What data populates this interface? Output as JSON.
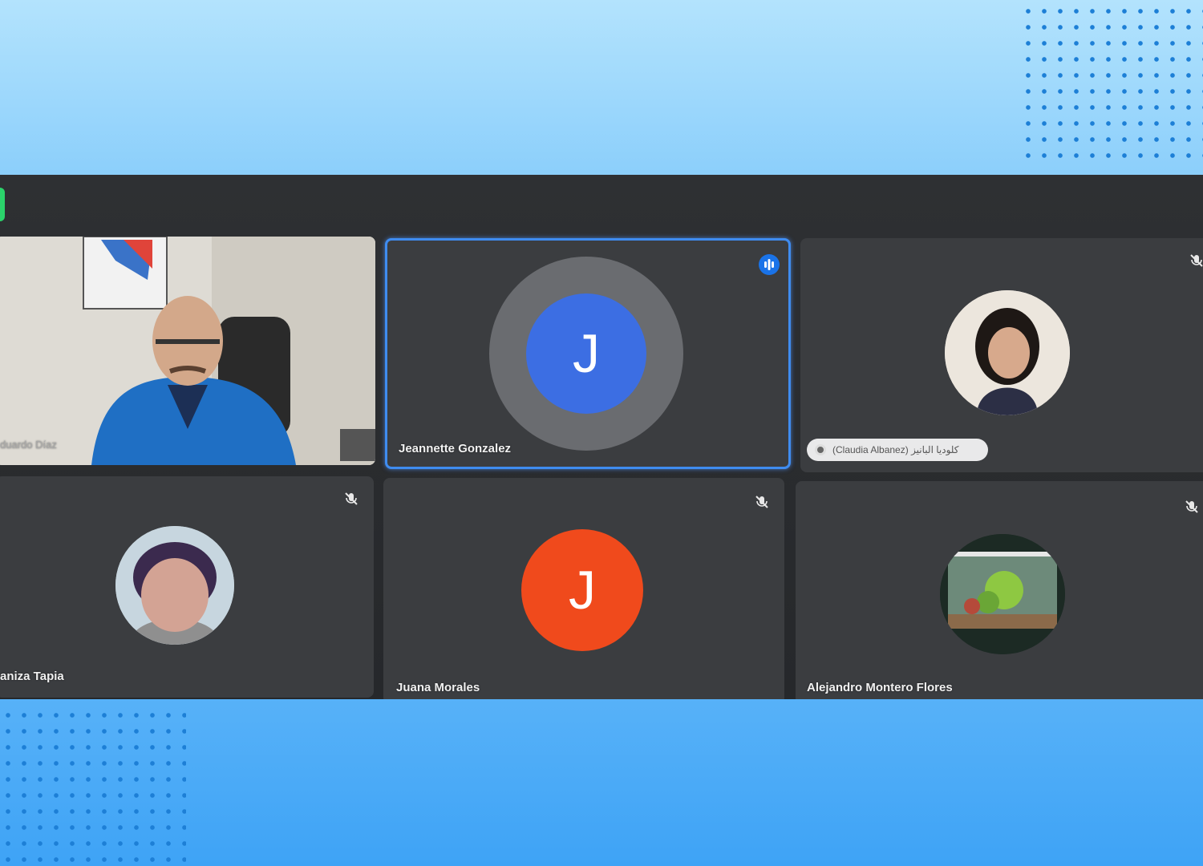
{
  "colors": {
    "accent_blue": "#3f8cf0",
    "avatar_blue": "#3c6ee3",
    "avatar_orange": "#f04a1c",
    "tile_bg": "#3b3d40",
    "recording_green": "#2bd36b"
  },
  "participants": [
    {
      "name": "Eduardo Díaz",
      "display_name": "duardo Díaz",
      "type": "video",
      "muted": false
    },
    {
      "name": "Jeannette Gonzalez",
      "type": "initial",
      "initial": "J",
      "avatar_color": "#3c6ee3",
      "speaking": true
    },
    {
      "name": "(Claudia Albanez) كلوديا البانيز",
      "display_name": "(Claudia Albanez) كلوديا البانيز",
      "type": "photo",
      "muted": true,
      "presenting_chip": true
    },
    {
      "name": "aniza Tapia",
      "display_name": "aniza Tapia",
      "type": "photo",
      "muted": true
    },
    {
      "name": "Juana Morales",
      "type": "initial",
      "initial": "J",
      "avatar_color": "#f04a1c",
      "muted": true
    },
    {
      "name": "Alejandro Montero Flores",
      "type": "photo",
      "muted": true
    }
  ]
}
